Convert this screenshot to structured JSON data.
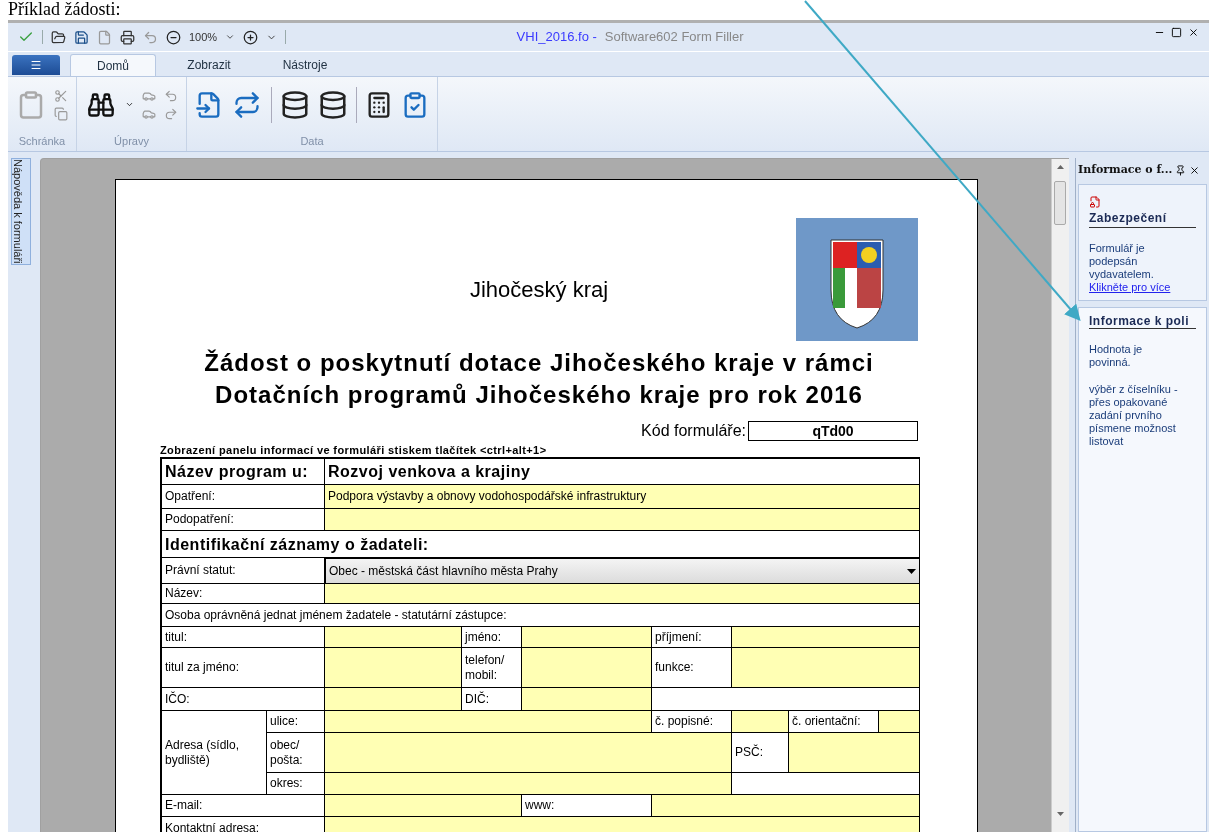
{
  "caption": "Příklad žádosti:",
  "window": {
    "title_file": "VHI_2016.fo -",
    "title_app": "Software602 Form Filler",
    "zoom": "100%"
  },
  "tabs": [
    {
      "label": "Domů",
      "selected": true
    },
    {
      "label": "Zobrazit",
      "selected": false
    },
    {
      "label": "Nástroje",
      "selected": false
    }
  ],
  "ribbon_groups": [
    {
      "label": "Schránka"
    },
    {
      "label": "Úpravy"
    },
    {
      "label": "Data"
    }
  ],
  "side_tab": "Nápověda k formuláři",
  "document": {
    "region": "Jihočeský kraj",
    "title": [
      "Žádost o poskytnutí dotace Jihočeského kraje v rámci",
      "Dotačních programů Jihočeského kraje pro rok 2016"
    ],
    "code_label": "Kód formuláře:",
    "code_value": "qTd00",
    "hint": "Zobrazení panelu informací ve formuláři stiskem tlačítek <ctrl+alt+1>",
    "cells": [
      {
        "kind": "heading",
        "text": "Název program u:"
      },
      {
        "kind": "heading",
        "text": "Rozvoj venkova a krajiny"
      },
      {
        "kind": "label",
        "text": "Opatření:"
      },
      {
        "kind": "field",
        "value": "Podpora výstavby a obnovy vodohospodářské infrastruktury"
      },
      {
        "kind": "label",
        "text": "Podopatření:"
      },
      {
        "kind": "field"
      },
      {
        "kind": "heading",
        "text": "Identifikační záznamy o žadateli:"
      },
      {
        "kind": "label",
        "text": "Právní statut:"
      },
      {
        "kind": "select",
        "value": "Obec - městská část hlavního města Prahy"
      },
      {
        "kind": "label",
        "text": "Název:"
      },
      {
        "kind": "field"
      },
      {
        "kind": "label",
        "text": "Osoba oprávněná jednat jménem žadatele - statutární zástupce:"
      },
      {
        "kind": "label",
        "text": "titul:"
      },
      {
        "kind": "field"
      },
      {
        "kind": "label",
        "text": "jméno:"
      },
      {
        "kind": "field"
      },
      {
        "kind": "label",
        "text": "příjmení:"
      },
      {
        "kind": "field"
      },
      {
        "kind": "label",
        "text": "titul za jméno:"
      },
      {
        "kind": "field"
      },
      {
        "kind": "label",
        "text": "telefon/ mobil:"
      },
      {
        "kind": "field"
      },
      {
        "kind": "label",
        "text": "funkce:"
      },
      {
        "kind": "field"
      },
      {
        "kind": "label",
        "text": "IČO:"
      },
      {
        "kind": "field"
      },
      {
        "kind": "label",
        "text": "DIČ:"
      },
      {
        "kind": "field"
      },
      {
        "kind": "blank"
      },
      {
        "kind": "label",
        "text": "Adresa (sídlo, bydliště)"
      },
      {
        "kind": "label",
        "text": "ulice:"
      },
      {
        "kind": "field"
      },
      {
        "kind": "label",
        "text": "č. popisné:"
      },
      {
        "kind": "field"
      },
      {
        "kind": "label",
        "text": "č. orientační:"
      },
      {
        "kind": "field"
      },
      {
        "kind": "label",
        "text": "obec/ pošta:"
      },
      {
        "kind": "field"
      },
      {
        "kind": "label",
        "text": "PSČ:"
      },
      {
        "kind": "field"
      },
      {
        "kind": "label",
        "text": "okres:"
      },
      {
        "kind": "field"
      },
      {
        "kind": "blank"
      },
      {
        "kind": "label",
        "text": "E-mail:"
      },
      {
        "kind": "field"
      },
      {
        "kind": "label",
        "text": "www:"
      },
      {
        "kind": "field"
      },
      {
        "kind": "label",
        "text": "Kontaktní adresa:"
      },
      {
        "kind": "field"
      }
    ]
  },
  "info_panel": {
    "title": "Informace o f...",
    "security": {
      "heading": "Zabezpečení",
      "text": "Formulář je podepsán vydavatelem.",
      "link": "Klikněte pro více"
    },
    "field_info": {
      "heading": "Informace k poli",
      "paragraphs": [
        "Hodnota je povinná.",
        "výběr z číselníku - přes opakované zadání prvního písmene možnost listovat"
      ]
    }
  }
}
